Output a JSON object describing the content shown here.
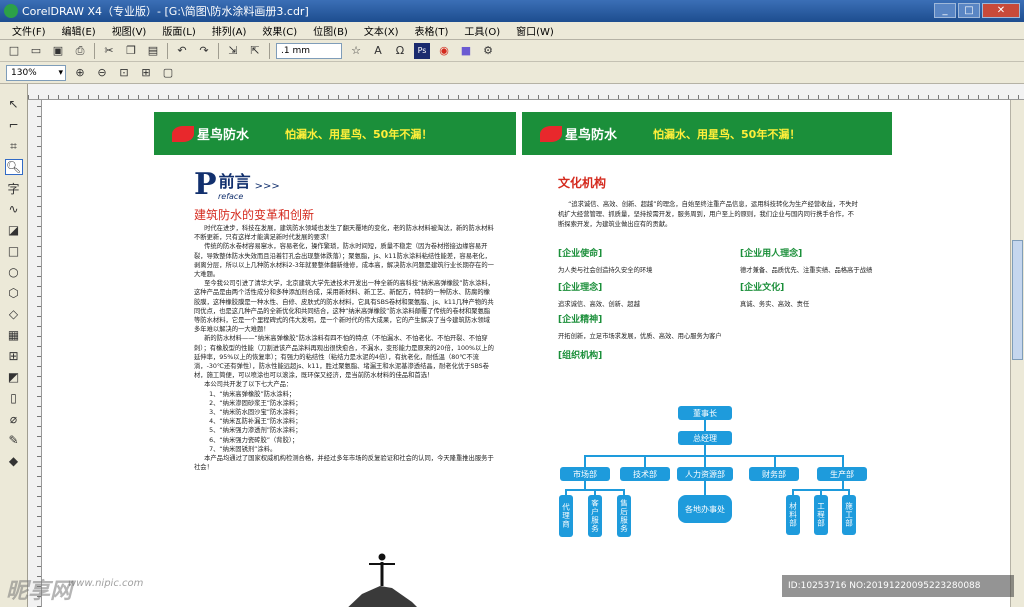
{
  "window": {
    "title": "CorelDRAW X4（专业版）- [G:\\简图\\防水涂料画册3.cdr]"
  },
  "menu": [
    "文件(F)",
    "编辑(E)",
    "视图(V)",
    "版面(L)",
    "排列(A)",
    "效果(C)",
    "位图(B)",
    "文本(X)",
    "表格(T)",
    "工具(O)",
    "窗口(W)"
  ],
  "toolbar": {
    "nudge": ".1 mm",
    "zoom": "130%"
  },
  "header": {
    "brand": "星鸟防水",
    "slogan": "怕漏水、用星鸟、50年不漏！"
  },
  "left_page": {
    "big_letter": "P",
    "title": "前言",
    "arrows": ">>>",
    "subtitle_en": "reface",
    "section_title": "建筑防水的变革和创新",
    "paragraphs": [
      "时代在进步，科技在发展，建筑防水领域也发生了翻天覆地的变化，老的防水材料被淘汰，新的防水材料不断更新，只有这样才能满足新时代发展的要求！",
      "传统的防水卷材容易窜水，容易老化，操作繁琐，防水时间短，质量不稳定（因为卷材搭接边缘容易开裂，导致整体防水失效而且沿着钉孔会出现整体跌落）；聚氨脂，js、k11防水涂料粘结性能差，容易老化，剥离分层，所以以上几种防水材料2-3年就要整体翻新维修，成本高，解决防水问题是建筑行业长期存在的一大难题。",
      "至今我公司引进了清华大学，北京建筑大学先进技术开发出一种全新的高科技“纳米高弹橡胶”防水涂料，这种产品是由两个活性成分和多种添加剂合成，采用新材料、新工艺、新配方，特制的一种防水、防腐的橡胶膜，这种橡胶膜是一种水性、自修、皮肤式的防水材料，它具有SBS卷材和聚氨脂、js、k11几种产物的共同优点，也是这几种产品的全新优化和共同结合，这种“纳米高弹橡胶”防水涂料颠覆了传统的卷材和聚氨脂等防水材料，它是一个里程碑式的伟大发明，是一个新时代的伟大成果，它的产生解决了当今建筑防水领域多年难以解决的一大难题！",
      "新的防水材料——“纳米高弹橡胶”防水涂料有四不怕的特点（不怕漏水、不怕老化、不怕开裂、不怕穿刺）；有橡胶型的性能（刀割进该产品涂料再观出很快愈合，不漏水，变形能力是原来的20倍，100%以上的延伸率，95%以上的恢复率）；有强力的粘结性（粘结力是水泥的4倍），有抗老化，耐低温（80℃不流淌，-30℃还有弹性），防水性能远超js、k11，胜过聚氨脂、堵漏王和水泥基渗透结晶，耐老化优于SBS卷材，施工简便，可以喷涂也可以滚涂，既环保又经济，是当前防水材料的佳品和首选！"
    ],
    "list_intro": "本公司共开发了以下七大产品：",
    "products": [
      "1、“纳米高弹橡胶”防水涂料；",
      "2、“纳米渗固砂浆王”防水涂料；",
      "3、“纳米防水固沙宝”防水涂料；",
      "4、“纳米瓦防补漏王”防水涂料；",
      "5、“纳米强力渗透剂”防水涂料；",
      "6、“纳米强力瓷砖胶”（背胶）；",
      "7、“纳米固锈剂”涂料。"
    ],
    "closing": "本产品均通过了国家权威机构检测合格，并经过多年市场的反复验证和社会的认同，今天隆重推出服务于社会！"
  },
  "right_page": {
    "title": "文化机构",
    "intro": "“追求诚信、高效、创新、超越”的理念，自始至终注重产品信息，运用科技转化为生产经营收益，不失时机扩大经营管理、抓质量，坚持按需开发，服务周到，用户至上的原则，我们企业与国内同行携手合作，不断探索开发，为建筑业做出应有的贡献。",
    "blocks": [
      {
        "heading": "[企业使命]",
        "text": "为人类与社会创造持久安全的环境"
      },
      {
        "heading": "[企业用人理念]",
        "text": "德才兼备、品质优先、注重实绩、品格高于战绩"
      },
      {
        "heading": "[企业理念]",
        "text": "追求诚信、高效、创新、超越"
      },
      {
        "heading": "[企业文化]",
        "text": "真诚、务实、高效、责任"
      },
      {
        "heading": "[企业精神]",
        "text": "开拓创新，立足市场求发展，优质、高效、用心服务为客户"
      },
      {
        "heading": "[组织机构]",
        "text": ""
      }
    ],
    "org": {
      "top": "董事长",
      "mid": "总经理",
      "depts": [
        "市场部",
        "技术部",
        "人力资源部",
        "财务部",
        "生产部"
      ],
      "subs": [
        "代理商",
        "客户服务",
        "售后服务",
        "各地办事处",
        "材料部",
        "工程部",
        "施工部"
      ]
    }
  },
  "watermark": {
    "text": "昵享网",
    "url": "www.nipic.com",
    "id": "ID:10253716 NO:20191220095223280088"
  }
}
